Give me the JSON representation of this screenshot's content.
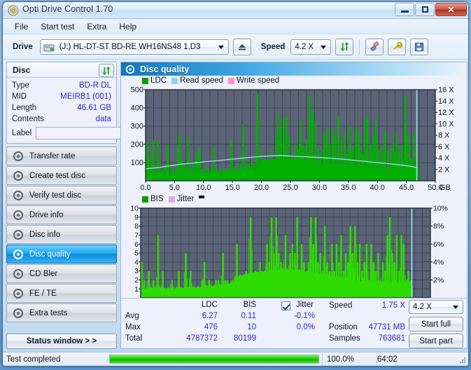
{
  "window": {
    "title": "Opti Drive Control 1.70",
    "icon": "disc-icon",
    "minimize": "minimize-icon",
    "maximize": "maximize-icon",
    "close": "✕"
  },
  "menu": {
    "items": [
      {
        "label": "File"
      },
      {
        "label": "Start test"
      },
      {
        "label": "Extra"
      },
      {
        "label": "Help"
      }
    ]
  },
  "toolbar": {
    "drive_label": "Drive",
    "drive_value": "(J:)  HL-DT-ST BD-RE  WH16NS48 1.D3",
    "eject_icon": "eject-icon",
    "speed_label": "Speed",
    "speed_value": "4.2 X",
    "refresh_icon": "refresh-icon",
    "erase_icon": "eraser-icon",
    "tools_icon": "tools-icon",
    "save_icon": "save-icon"
  },
  "disc_panel": {
    "header": "Disc",
    "refresh_icon": "refresh-icon",
    "rows": [
      {
        "key": "Type",
        "value": "BD-R DL"
      },
      {
        "key": "MID",
        "value": "MEIRB1 (001)"
      },
      {
        "key": "Length",
        "value": "46.61 GB"
      },
      {
        "key": "Contents",
        "value": "data"
      }
    ],
    "label_key": "Label",
    "label_value": "",
    "label_placeholder": "",
    "disc_button_icon": "cd-icon"
  },
  "sidebar": {
    "items": [
      {
        "label": "Transfer rate",
        "icon": "disc-icon",
        "active": false
      },
      {
        "label": "Create test disc",
        "icon": "disc-icon",
        "active": false
      },
      {
        "label": "Verify test disc",
        "icon": "disc-icon",
        "active": false
      },
      {
        "label": "Drive info",
        "icon": "disc-icon",
        "active": false
      },
      {
        "label": "Disc info",
        "icon": "disc-icon",
        "active": false
      },
      {
        "label": "Disc quality",
        "icon": "disc-icon",
        "active": true
      },
      {
        "label": "CD Bler",
        "icon": "disc-icon",
        "active": false
      },
      {
        "label": "FE / TE",
        "icon": "disc-icon",
        "active": false
      },
      {
        "label": "Extra tests",
        "icon": "disc-icon",
        "active": false
      }
    ],
    "status_button": "Status window > >"
  },
  "main": {
    "panel_title": "Disc quality",
    "panel_icon": "disc-icon"
  },
  "colors": {
    "ldc_green": "#00c000",
    "bis_green": "#2ddb00",
    "read_speed": "#8fd4f5",
    "write_speed": "#ff8fd4",
    "jitter_pink": "#d9b0d9",
    "plot_bg": "#5b6378",
    "accent_blue": "#2a2ad0"
  },
  "chart_data": [
    {
      "type": "bar",
      "id": "disc-quality-ldc-chart",
      "title": "",
      "legend": [
        {
          "label": "LDC",
          "color": "#00b000"
        },
        {
          "label": "Read speed",
          "color": "#8fd4f5"
        },
        {
          "label": "Write speed",
          "color": "#ff8fd4"
        }
      ],
      "legend_position": "top-left",
      "grid": true,
      "xlabel": "GB",
      "xlim": [
        0,
        50
      ],
      "xticks": [
        "0.0",
        "5.0",
        "10.0",
        "15.0",
        "20.0",
        "25.0",
        "30.0",
        "35.0",
        "40.0",
        "45.0",
        "50.0"
      ],
      "ylabel": "LDC",
      "ylim": [
        0,
        500
      ],
      "yticks": [
        100,
        200,
        300,
        400,
        500
      ],
      "y2label": "Speed",
      "y2lim": [
        0,
        16
      ],
      "y2ticks": [
        "2 X",
        "4 X",
        "6 X",
        "8 X",
        "10 X",
        "12 X",
        "14 X",
        "16 X"
      ],
      "series": [
        {
          "name": "LDC",
          "color": "#00b000",
          "note": "error spikes across 0-46.8 GB, baseline ~30-60, dense tall spikes 20-46 GB",
          "x": [
            0.2,
            0.5,
            0.9,
            1.3,
            1.7,
            2.1,
            2.6,
            3.0,
            3.4,
            3.8,
            4.3,
            4.8,
            5.3,
            5.8,
            6.3,
            6.8,
            7.3,
            7.8,
            8.3,
            8.8,
            9.3,
            9.8,
            10.3,
            10.8,
            11.3,
            11.8,
            12.3,
            12.8,
            13.3,
            13.8,
            14.3,
            14.8,
            15.3,
            15.8,
            16.3,
            16.8,
            17.3,
            17.8,
            18.3,
            18.8,
            19.3,
            19.8,
            20.3,
            20.8,
            21.3,
            21.8,
            22.3,
            22.8,
            23.3,
            23.8,
            24.3,
            24.8,
            25.3,
            25.8,
            26.3,
            26.8,
            27.3,
            27.8,
            28.3,
            28.8,
            29.3,
            29.8,
            30.3,
            30.8,
            31.3,
            31.8,
            32.3,
            32.8,
            33.3,
            33.8,
            34.3,
            34.8,
            35.3,
            35.8,
            36.3,
            36.8,
            37.3,
            37.8,
            38.3,
            38.8,
            39.3,
            39.8,
            40.3,
            40.8,
            41.3,
            41.8,
            42.3,
            42.8,
            43.3,
            43.8,
            44.3,
            44.8,
            45.3,
            45.8,
            46.3,
            46.8
          ],
          "values": [
            215,
            140,
            60,
            225,
            50,
            215,
            70,
            60,
            85,
            195,
            80,
            60,
            70,
            255,
            110,
            80,
            240,
            70,
            100,
            150,
            190,
            65,
            70,
            70,
            60,
            185,
            70,
            60,
            60,
            70,
            65,
            220,
            60,
            100,
            60,
            310,
            90,
            80,
            120,
            70,
            480,
            140,
            120,
            105,
            60,
            165,
            100,
            365,
            300,
            345,
            355,
            250,
            130,
            200,
            170,
            330,
            195,
            230,
            470,
            395,
            330,
            170,
            150,
            260,
            295,
            205,
            290,
            250,
            355,
            225,
            260,
            150,
            300,
            180,
            290,
            260,
            160,
            345,
            340,
            200,
            255,
            340,
            170,
            195,
            275,
            165,
            185,
            215,
            265,
            150,
            200,
            465,
            250,
            120,
            265,
            190
          ]
        },
        {
          "name": "Read speed",
          "color": "#8fd4f5",
          "note": "CAV-like read curve rising then falling, in X units",
          "x": [
            0,
            2,
            4,
            6,
            8,
            10,
            12,
            14,
            16,
            18,
            20,
            22,
            23,
            24,
            26,
            28,
            30,
            32,
            34,
            36,
            38,
            40,
            42,
            44,
            46,
            46.8
          ],
          "values": [
            2.1,
            2.3,
            2.6,
            2.9,
            3.1,
            3.3,
            3.5,
            3.7,
            3.9,
            4.1,
            4.3,
            4.4,
            4.45,
            4.4,
            4.3,
            4.2,
            4.1,
            3.95,
            3.8,
            3.6,
            3.4,
            3.2,
            3.0,
            2.8,
            2.5,
            2.3
          ]
        },
        {
          "name": "Write speed",
          "color": "#ff8fd4",
          "values": []
        }
      ]
    },
    {
      "type": "bar",
      "id": "disc-quality-bis-chart",
      "title": "",
      "legend": [
        {
          "label": "BIS",
          "color": "#00b000"
        },
        {
          "label": "Jitter",
          "color": "#d9b0d9"
        }
      ],
      "legend_position": "top-left",
      "grid": true,
      "xlabel": "GB",
      "xlim": [
        0,
        50
      ],
      "xticks": [
        "0.0",
        "5.0",
        "10.0",
        "15.0",
        "20.0",
        "25.0",
        "30.0",
        "35.0",
        "40.0",
        "45.0",
        "50.0"
      ],
      "ylabel": "BIS",
      "ylim": [
        0,
        10
      ],
      "yticks": [
        1,
        2,
        3,
        4,
        5,
        6,
        7,
        8,
        9,
        10
      ],
      "y2label": "Jitter",
      "y2lim": [
        0,
        10
      ],
      "y2ticks": [
        "2%",
        "4%",
        "6%",
        "8%",
        "10%"
      ],
      "series": [
        {
          "name": "BIS",
          "color": "#2ddb00",
          "note": "baseline ~1 rising to ~2-3 after 22 GB, with spikes to 9",
          "x": [
            0.2,
            0.6,
            1.0,
            1.4,
            1.8,
            2.2,
            2.6,
            3.0,
            3.4,
            3.8,
            4.2,
            4.6,
            5.0,
            5.4,
            5.8,
            6.2,
            6.6,
            7.0,
            7.4,
            7.8,
            8.2,
            8.6,
            9.0,
            9.4,
            9.8,
            10.2,
            10.6,
            11.0,
            11.4,
            11.8,
            12.2,
            12.6,
            13.0,
            13.4,
            13.8,
            14.2,
            14.6,
            15.0,
            15.4,
            15.8,
            16.2,
            16.6,
            17.0,
            17.4,
            17.8,
            18.2,
            18.6,
            19.0,
            19.4,
            19.8,
            20.2,
            20.6,
            21.0,
            21.4,
            21.8,
            22.2,
            22.6,
            23.0,
            23.4,
            23.8,
            24.2,
            24.6,
            25.0,
            25.4,
            25.8,
            26.2,
            26.6,
            27.0,
            27.4,
            27.8,
            28.2,
            28.6,
            29.0,
            29.4,
            29.8,
            30.2,
            30.6,
            31.0,
            31.4,
            31.8,
            32.2,
            32.6,
            33.0,
            33.4,
            33.8,
            34.2,
            34.6,
            35.0,
            35.4,
            35.8,
            36.2,
            36.6,
            37.0,
            37.4,
            37.8,
            38.2,
            38.6,
            39.0,
            39.4,
            39.8,
            40.2,
            40.6,
            41.0,
            41.4,
            41.8,
            42.2,
            42.6,
            43.0,
            43.4,
            43.8,
            44.2,
            44.6,
            45.0,
            45.4,
            45.8,
            46.2,
            46.6
          ],
          "values": [
            4,
            2,
            1,
            3,
            1,
            2,
            1,
            7,
            1,
            3,
            1,
            1,
            1,
            2,
            1,
            1,
            3,
            1,
            1,
            5,
            1,
            3,
            1,
            1,
            1,
            1,
            2,
            4,
            1,
            2,
            1,
            1,
            2,
            2,
            1,
            5,
            2,
            2,
            1,
            2,
            2,
            6,
            2,
            2,
            1,
            3,
            2,
            9,
            2,
            3,
            2,
            4,
            2,
            3,
            6,
            4,
            9,
            5,
            9,
            5,
            4,
            3,
            7,
            3,
            5,
            6,
            5,
            9,
            3,
            6,
            4,
            2,
            4,
            9,
            6,
            9,
            4,
            5,
            3,
            8,
            4,
            3,
            6,
            3,
            6,
            4,
            7,
            3,
            5,
            4,
            8,
            5,
            8,
            4,
            6,
            3,
            4,
            6,
            2,
            6,
            4,
            3,
            5,
            2,
            4,
            3,
            7,
            9,
            5,
            4,
            7,
            3,
            7,
            6,
            2,
            3,
            2
          ]
        },
        {
          "name": "Jitter",
          "color": "#d9b0d9",
          "values": []
        }
      ]
    }
  ],
  "stats": {
    "col_headers": [
      "LDC",
      "BIS"
    ],
    "row_headers": [
      "Avg",
      "Max",
      "Total"
    ],
    "ldc": {
      "avg": "6.27",
      "max": "476",
      "total": "4787372"
    },
    "bis": {
      "avg": "0.11",
      "max": "10",
      "total": "80199"
    },
    "jitter_label": "Jitter",
    "jitter_checked": true,
    "jitter_avg": "-0.1%",
    "jitter_max": "0.0%",
    "speed_label": "Speed",
    "speed_value": "1.75 X",
    "position_label": "Position",
    "position_value": "47731 MB",
    "samples_label": "Samples",
    "samples_value": "763681",
    "speed_select": "4.2 X",
    "start_full": "Start full",
    "start_part": "Start part"
  },
  "statusbar": {
    "message": "Test completed",
    "progress_percent": 100.0,
    "progress_text": "100.0%",
    "elapsed": "64:02"
  }
}
